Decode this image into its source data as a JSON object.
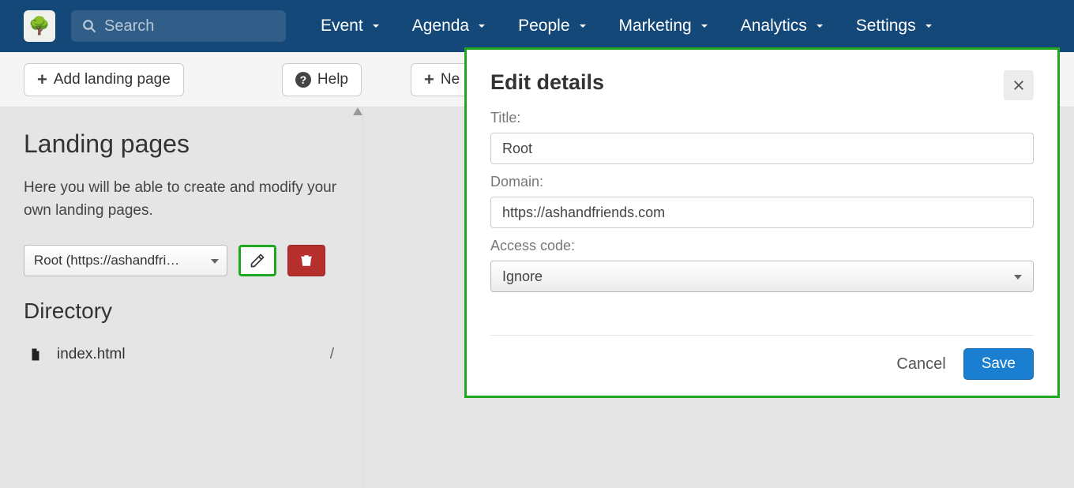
{
  "search": {
    "placeholder": "Search"
  },
  "nav": {
    "items": [
      {
        "label": "Event"
      },
      {
        "label": "Agenda"
      },
      {
        "label": "People"
      },
      {
        "label": "Marketing"
      },
      {
        "label": "Analytics"
      },
      {
        "label": "Settings"
      }
    ]
  },
  "toolbar": {
    "add_landing_label": "Add landing page",
    "help_label": "Help",
    "new_label": "Ne"
  },
  "left": {
    "title": "Landing pages",
    "desc": "Here you will be able to create and modify your own landing pages.",
    "select_value": "Root (https://ashandfri…",
    "directory_title": "Directory",
    "files": [
      {
        "name": "index.html",
        "path": "/"
      }
    ]
  },
  "modal": {
    "title": "Edit details",
    "title_label": "Title:",
    "title_value": "Root",
    "domain_label": "Domain:",
    "domain_value": "https://ashandfriends.com",
    "access_label": "Access code:",
    "access_value": "Ignore",
    "cancel_label": "Cancel",
    "save_label": "Save"
  }
}
